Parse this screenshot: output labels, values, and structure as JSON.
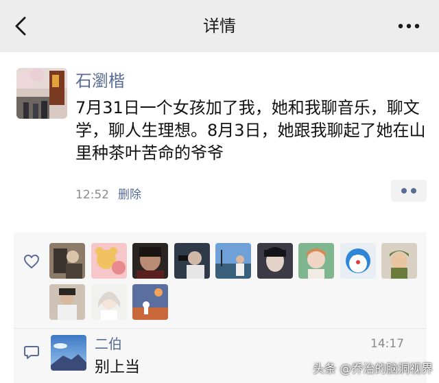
{
  "navbar": {
    "title": "详情",
    "back_icon": "chevron-left-icon",
    "more_icon": "more-horizontal-icon"
  },
  "post": {
    "username": "石瀏楷",
    "text": "7月31日一个女孩加了我，她和我聊音乐，聊文学，聊人生理想。8月3日，她跟我聊起了她在山里种茶叶苦命的爷爷",
    "time": "12:52",
    "delete_label": "删除",
    "more_action_icon": "two-dots-icon"
  },
  "likes": {
    "icon": "heart-icon",
    "count": 12
  },
  "comments": [
    {
      "author": "二伯",
      "time": "14:17",
      "text": "别上当"
    }
  ],
  "comment_icon": "comment-bubble-icon",
  "watermark": "头条 @乔治的脑洞视界",
  "colors": {
    "link": "#576b95",
    "navbar_bg": "#ededed",
    "panel_bg": "#f7f7f7"
  }
}
